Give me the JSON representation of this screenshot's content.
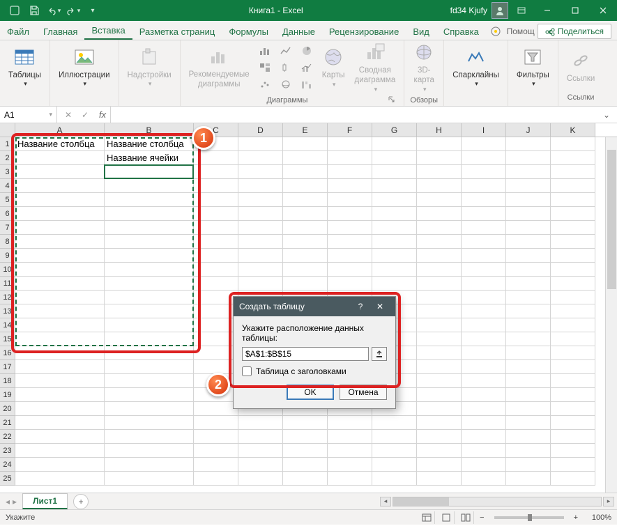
{
  "titlebar": {
    "title": "Книга1 - Excel",
    "user": "fd34 Kjufy"
  },
  "tabs": {
    "file": "Файл",
    "items": [
      "Главная",
      "Вставка",
      "Разметка страниц",
      "Формулы",
      "Данные",
      "Рецензирование",
      "Вид",
      "Справка"
    ],
    "active": "Вставка",
    "help": "Помощ",
    "share": "Поделиться"
  },
  "ribbon": {
    "tables": "Таблицы",
    "illustrations": "Иллюстрации",
    "addins": "Надстройки",
    "rec_charts": "Рекомендуемые\nдиаграммы",
    "charts_group": "Диаграммы",
    "maps": "Карты",
    "pivot_chart": "Сводная\nдиаграмма",
    "tours_group": "Обзоры",
    "3dmap": "3D-\nкарта",
    "sparklines": "Спарклайны",
    "filters": "Фильтры",
    "links": "Ссылки",
    "links_group": "Ссылки"
  },
  "formula_bar": {
    "name_box": "A1",
    "fx": "fx"
  },
  "columns": [
    "A",
    "B",
    "C",
    "D",
    "E",
    "F",
    "G",
    "H",
    "I",
    "J",
    "K"
  ],
  "cells": {
    "A1": "Название столбца",
    "B1": "Название столбца",
    "B2": "Название ячейки"
  },
  "dialog": {
    "title": "Создать таблицу",
    "label": "Укажите расположение данных таблицы:",
    "range": "$A$1:$B$15",
    "checkbox": "Таблица с заголовками",
    "ok": "OK",
    "cancel": "Отмена"
  },
  "sheet": {
    "name": "Лист1"
  },
  "status": {
    "text": "Укажите",
    "zoom": "100%"
  }
}
